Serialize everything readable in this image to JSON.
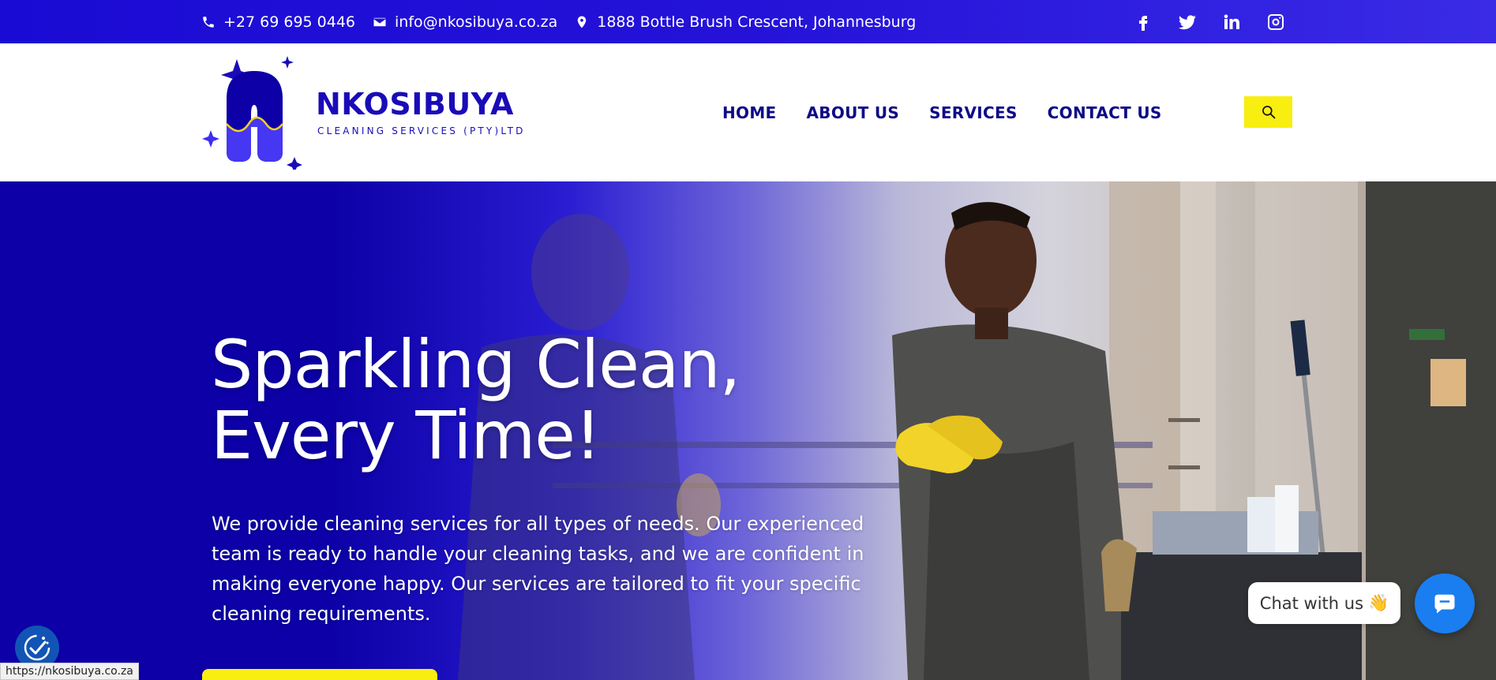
{
  "topbar": {
    "phone": "+27 69 695 0446",
    "email": "info@nkosibuya.co.za",
    "address": "1888 Bottle Brush Crescent, Johannesburg",
    "social_icons": [
      "facebook-icon",
      "twitter-icon",
      "linkedin-icon",
      "instagram-icon"
    ]
  },
  "brand": {
    "name": "NKOSIBUYA",
    "subtitle": "CLEANING SERVICES (PTY)LTD"
  },
  "nav": {
    "items": [
      "HOME",
      "ABOUT US",
      "SERVICES",
      "CONTACT US"
    ]
  },
  "hero": {
    "title_line1": "Sparkling Clean,",
    "title_line2": "Every Time!",
    "description": "We provide cleaning services for all types of needs. Our experienced team is ready to handle your cleaning tasks, and we are confident in making everyone happy. Our services are tailored to fit your specific cleaning requirements."
  },
  "chat": {
    "label": "Chat with us",
    "emoji": "👋"
  },
  "status_bar": {
    "url": "https://nkosibuya.co.za"
  },
  "colors": {
    "brand_blue": "#1a0bb8",
    "topbar_blue": "#2412d8",
    "accent_yellow": "#f8ee10",
    "chat_blue": "#1a7ef0"
  }
}
